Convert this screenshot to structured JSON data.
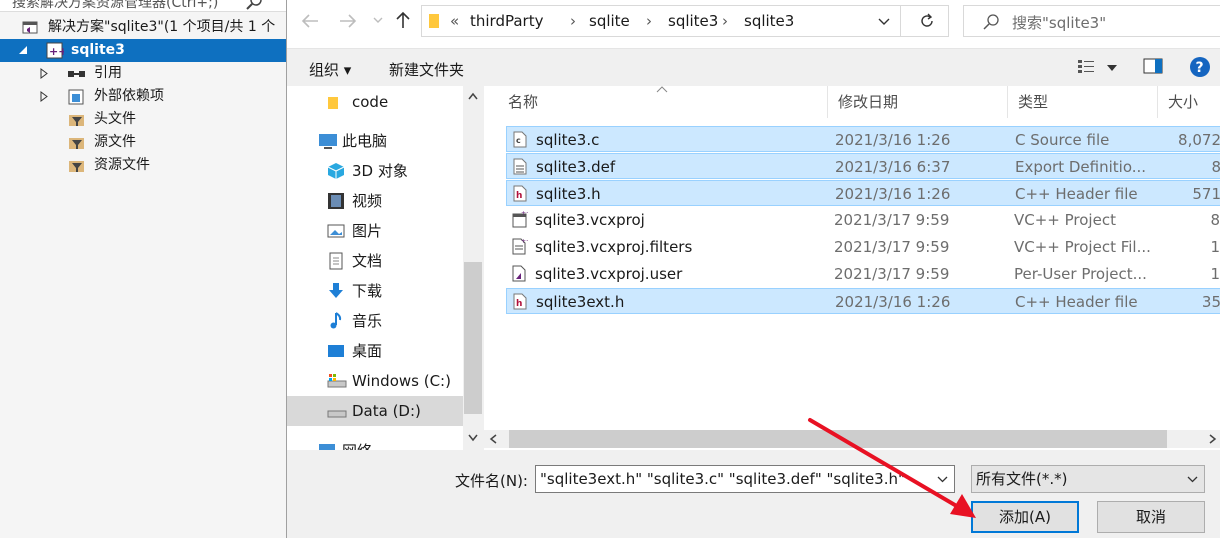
{
  "solution_explorer": {
    "search_placeholder": "搜索解决方案资源管理器(Ctrl+;)",
    "solution_label": "解决方案\"sqlite3\"(1 个项目/共 1 个",
    "project_label": "sqlite3",
    "items": [
      {
        "label": "引用"
      },
      {
        "label": "外部依赖项"
      },
      {
        "label": "头文件"
      },
      {
        "label": "源文件"
      },
      {
        "label": "资源文件"
      }
    ]
  },
  "dialog": {
    "breadcrumb": [
      "«",
      "thirdParty",
      "sqlite",
      "sqlite3",
      "sqlite3"
    ],
    "search_placeholder": "搜索\"sqlite3\"",
    "toolbar": {
      "organize": "组织 ▾",
      "new_folder": "新建文件夹"
    },
    "nav_items": [
      {
        "label": "code",
        "icon": "folder-icon"
      },
      {
        "label": "此电脑",
        "icon": "computer-icon"
      },
      {
        "label": "3D 对象",
        "icon": "3d-objects-icon"
      },
      {
        "label": "视频",
        "icon": "video-icon"
      },
      {
        "label": "图片",
        "icon": "pictures-icon"
      },
      {
        "label": "文档",
        "icon": "documents-icon"
      },
      {
        "label": "下载",
        "icon": "download-icon"
      },
      {
        "label": "音乐",
        "icon": "music-icon"
      },
      {
        "label": "桌面",
        "icon": "desktop-icon"
      },
      {
        "label": "Windows (C:)",
        "icon": "drive-icon"
      },
      {
        "label": "Data (D:)",
        "icon": "drive-icon"
      },
      {
        "label": "网络",
        "icon": "network-icon"
      }
    ],
    "columns": {
      "name": "名称",
      "date": "修改日期",
      "type": "类型",
      "size": "大小"
    },
    "files": [
      {
        "name": "sqlite3.c",
        "date": "2021/3/16 1:26",
        "type": "C Source file",
        "size": "8,072",
        "selected": true,
        "icon": "c-source-icon"
      },
      {
        "name": "sqlite3.def",
        "date": "2021/3/16 6:37",
        "type": "Export Definitio...",
        "size": "8",
        "selected": true,
        "icon": "def-file-icon"
      },
      {
        "name": "sqlite3.h",
        "date": "2021/3/16 1:26",
        "type": "C++ Header file",
        "size": "571",
        "selected": true,
        "icon": "header-file-icon"
      },
      {
        "name": "sqlite3.vcxproj",
        "date": "2021/3/17 9:59",
        "type": "VC++ Project",
        "size": "8",
        "selected": false,
        "icon": "vcxproj-icon"
      },
      {
        "name": "sqlite3.vcxproj.filters",
        "date": "2021/3/17 9:59",
        "type": "VC++ Project Fil...",
        "size": "1",
        "selected": false,
        "icon": "filters-icon"
      },
      {
        "name": "sqlite3.vcxproj.user",
        "date": "2021/3/17 9:59",
        "type": "Per-User Project...",
        "size": "1",
        "selected": false,
        "icon": "user-proj-icon"
      },
      {
        "name": "sqlite3ext.h",
        "date": "2021/3/16 1:26",
        "type": "C++ Header file",
        "size": "35",
        "selected": true,
        "icon": "header-file-icon"
      }
    ],
    "filename_label": "文件名(N):",
    "filename_value": "\"sqlite3ext.h\" \"sqlite3.c\" \"sqlite3.def\" \"sqlite3.h\"",
    "filetype_value": "所有文件(*.*)",
    "add_button": "添加(A)",
    "cancel_button": "取消"
  },
  "colors": {
    "selection_blue": "#0e70c0",
    "row_select": "#cce8ff",
    "arrow": "#e81123"
  }
}
